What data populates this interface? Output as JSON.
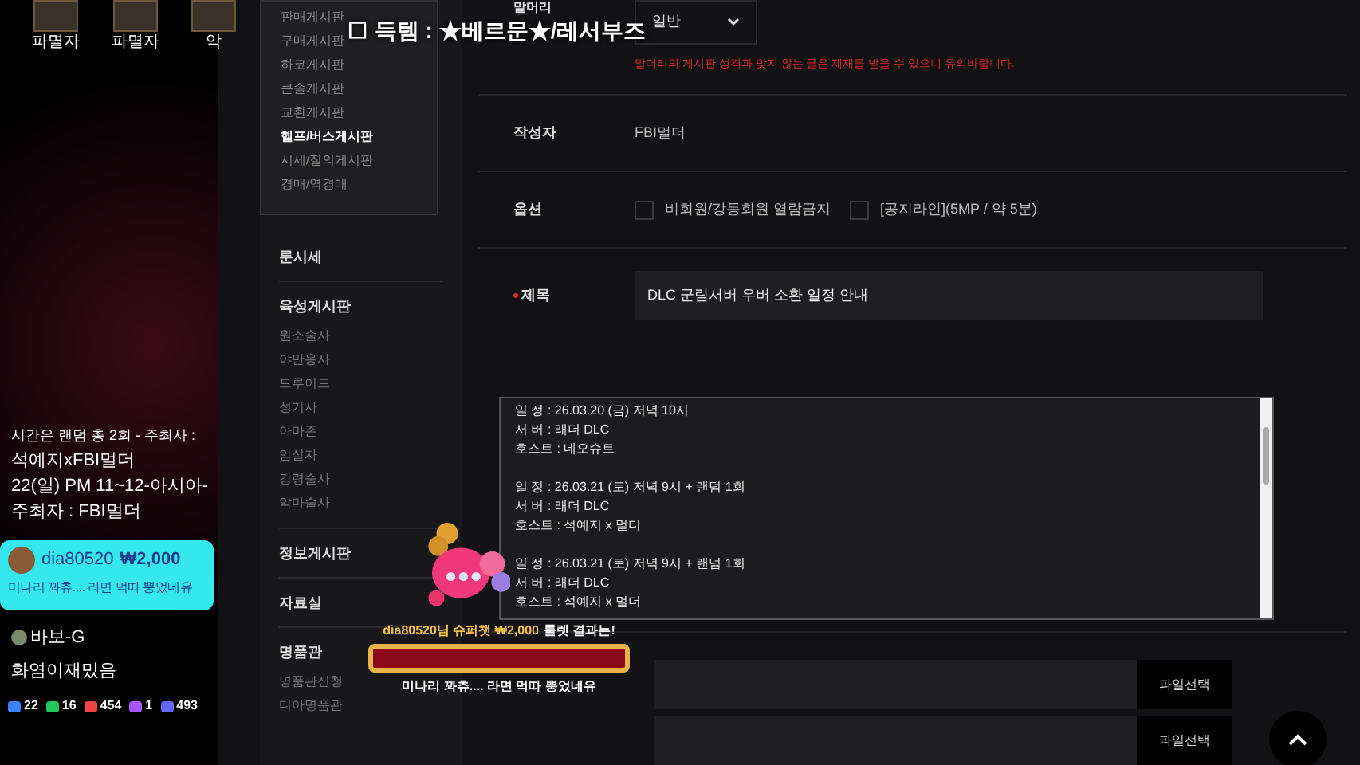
{
  "stream_panel": {
    "top_avatars": [
      {
        "label": "파멸자"
      },
      {
        "label": "파멸자"
      },
      {
        "label": "악"
      }
    ],
    "event_lines": [
      "시간은 랜덤 총 2회 - 주최사 :",
      "석예지xFBI멀더",
      "22(일) PM 11~12-아시아-",
      "주최자 : FBI멀더"
    ],
    "donation_card": {
      "user": "dia80520",
      "amount": "₩2,000",
      "message": "미나리 꽈츄.... 라면 먹따 뿡었네유"
    },
    "chat": {
      "user": "바보-G",
      "message": "화염이재밌음"
    },
    "stats": [
      {
        "value": "22",
        "color": "#3b82f6"
      },
      {
        "value": "16",
        "color": "#22c55e"
      },
      {
        "value": "454",
        "color": "#ef4444"
      },
      {
        "value": "1",
        "color": "#a855f7"
      },
      {
        "value": "493",
        "color": "#6366f1"
      }
    ]
  },
  "stream_title": "☐ 득템 : ★베르문★/레서부즈",
  "board_menu": [
    {
      "label": "판매게시판",
      "selected": false
    },
    {
      "label": "구매게시판",
      "selected": false
    },
    {
      "label": "하코게시판",
      "selected": false
    },
    {
      "label": "큰솔게시판",
      "selected": false
    },
    {
      "label": "교환게시판",
      "selected": false
    },
    {
      "label": "헬프/버스게시판",
      "selected": true
    },
    {
      "label": "시세/질의게시판",
      "selected": false
    },
    {
      "label": "경매/역경매",
      "selected": false
    }
  ],
  "sidebar": [
    {
      "label": "룬시세"
    },
    {
      "label": "육성게시판",
      "children": [
        "원소술사",
        "야만용사",
        "드루이드",
        "성기사",
        "아마존",
        "암살자",
        "강령술사",
        "악마술사"
      ]
    },
    {
      "label": "정보게시판"
    },
    {
      "label": "자료실"
    },
    {
      "label": "명품관",
      "children": [
        "명품관신청",
        "디아명품관"
      ]
    }
  ],
  "form": {
    "category": {
      "label": "말머리",
      "value": "일반",
      "warning": "말머리의 게시판 성격과 맞지 않는 글은 제재를 받을 수 있으니 유의바랍니다."
    },
    "author": {
      "label": "작성자",
      "value": "FBI멀더"
    },
    "options": {
      "label": "옵션",
      "items": [
        {
          "label": "비회원/강등회원 열람금지",
          "checked": false
        },
        {
          "label": "[공지라인](5MP / 약 5분)",
          "checked": false
        }
      ]
    },
    "subject": {
      "label": "제목",
      "required": true,
      "value": "DLC 군림서버 우버 소환 일정 안내"
    },
    "content": "일 정 : 26.03.20 (금)  저녁 10시\n서 버 :  래더 DLC\n호스트 : 네오슈트\n\n일 정 : 26.03.21 (토)  저녁 9시 + 랜덤 1회\n서 버 :  래더 DLC\n호스트 : 석예지 x 멀더\n\n일 정 : 26.03.21 (토)  저녁 9시 + 랜덤 1회\n서 버 :  래더 DLC\n호스트 : 석예지 x 멀더",
    "file_buttons": [
      "파일선택",
      "파일선택"
    ]
  },
  "donation_alert": {
    "headline": "dia80520님 슈퍼챗 ₩2,000",
    "headline_end": "룰렛 결과는!",
    "message": "미나리 꽈츄.... 라면 먹따 뿡었네유"
  }
}
